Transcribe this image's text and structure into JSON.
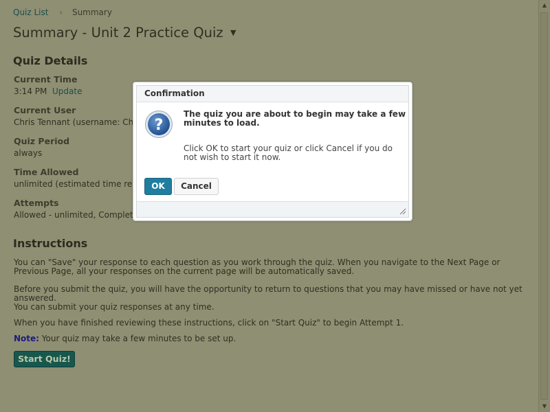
{
  "breadcrumb": {
    "link": "Quiz List",
    "current": "Summary"
  },
  "page": {
    "title": "Summary - Unit 2 Practice Quiz"
  },
  "details": {
    "heading": "Quiz Details",
    "current_time_label": "Current Time",
    "current_time_value": "3:14 PM",
    "update_link": "Update",
    "current_user_label": "Current User",
    "current_user_value": "Chris Tennant (username: Chr",
    "quiz_period_label": "Quiz Period",
    "quiz_period_value": "always",
    "time_allowed_label": "Time Allowed",
    "time_allowed_value": "unlimited (estimated time requ",
    "attempts_label": "Attempts",
    "attempts_value": "Allowed - unlimited, Complete"
  },
  "instructions": {
    "heading": "Instructions",
    "p1": "You can \"Save\" your response to each question as you work through the quiz. When you navigate to the Next Page or Previous Page, all your responses on the current page will be automatically saved.",
    "p2a": "Before you submit the quiz, you will have the opportunity to return to questions that you may have missed or have not yet answered.",
    "p2b": "You can submit your quiz responses at any time.",
    "p3": "When you have finished reviewing these instructions, click on \"Start Quiz\" to begin Attempt 1.",
    "note_label": "Note:",
    "note_text": "Your quiz may take a few minutes to be set up.",
    "start_button": "Start Quiz!"
  },
  "dialog": {
    "title": "Confirmation",
    "message": "The quiz you are about to begin may take a few minutes to load.",
    "submessage": "Click OK to start your quiz or click Cancel if you do not wish to start it now.",
    "ok_label": "OK",
    "cancel_label": "Cancel"
  },
  "colors": {
    "overlay_bg": "#8f8f73",
    "primary_button": "#1f7ea0",
    "start_button": "#17574e",
    "link": "#1d4d4a"
  }
}
